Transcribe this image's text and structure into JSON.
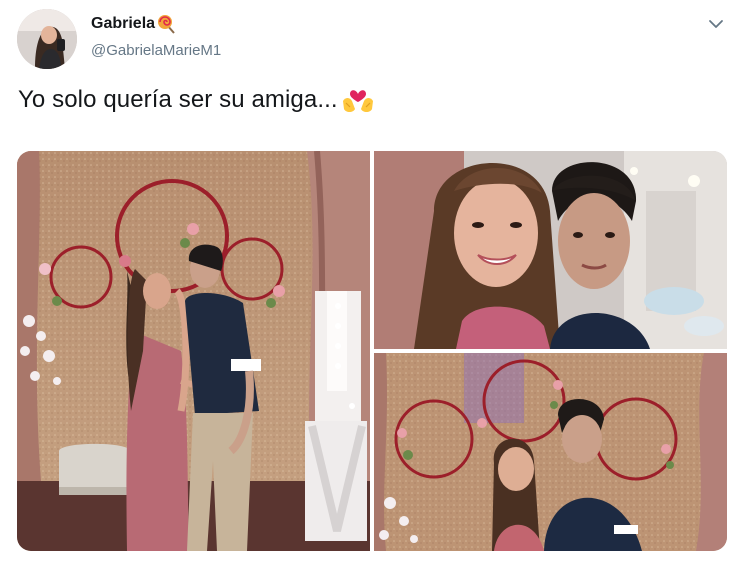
{
  "author": {
    "display_name": "Gabriela",
    "handle": "@GabrielaMarieM1",
    "name_emoji_icon": "lollipop-icon",
    "avatar_icon": "avatar-photo"
  },
  "tweet": {
    "text": "Yo solo quería ser su amiga...",
    "text_emoji_icon": "hands-heart-icon"
  },
  "menu": {
    "icon": "chevron-down-icon"
  },
  "media": {
    "photos": [
      "photo-couple-kissing",
      "photo-selfie",
      "photo-couple-posing"
    ]
  },
  "colors": {
    "text": "#14171a",
    "secondary": "#657786",
    "backdrop": "#b98f72",
    "curtain": "#b67f72",
    "hoop": "#a0202a"
  }
}
